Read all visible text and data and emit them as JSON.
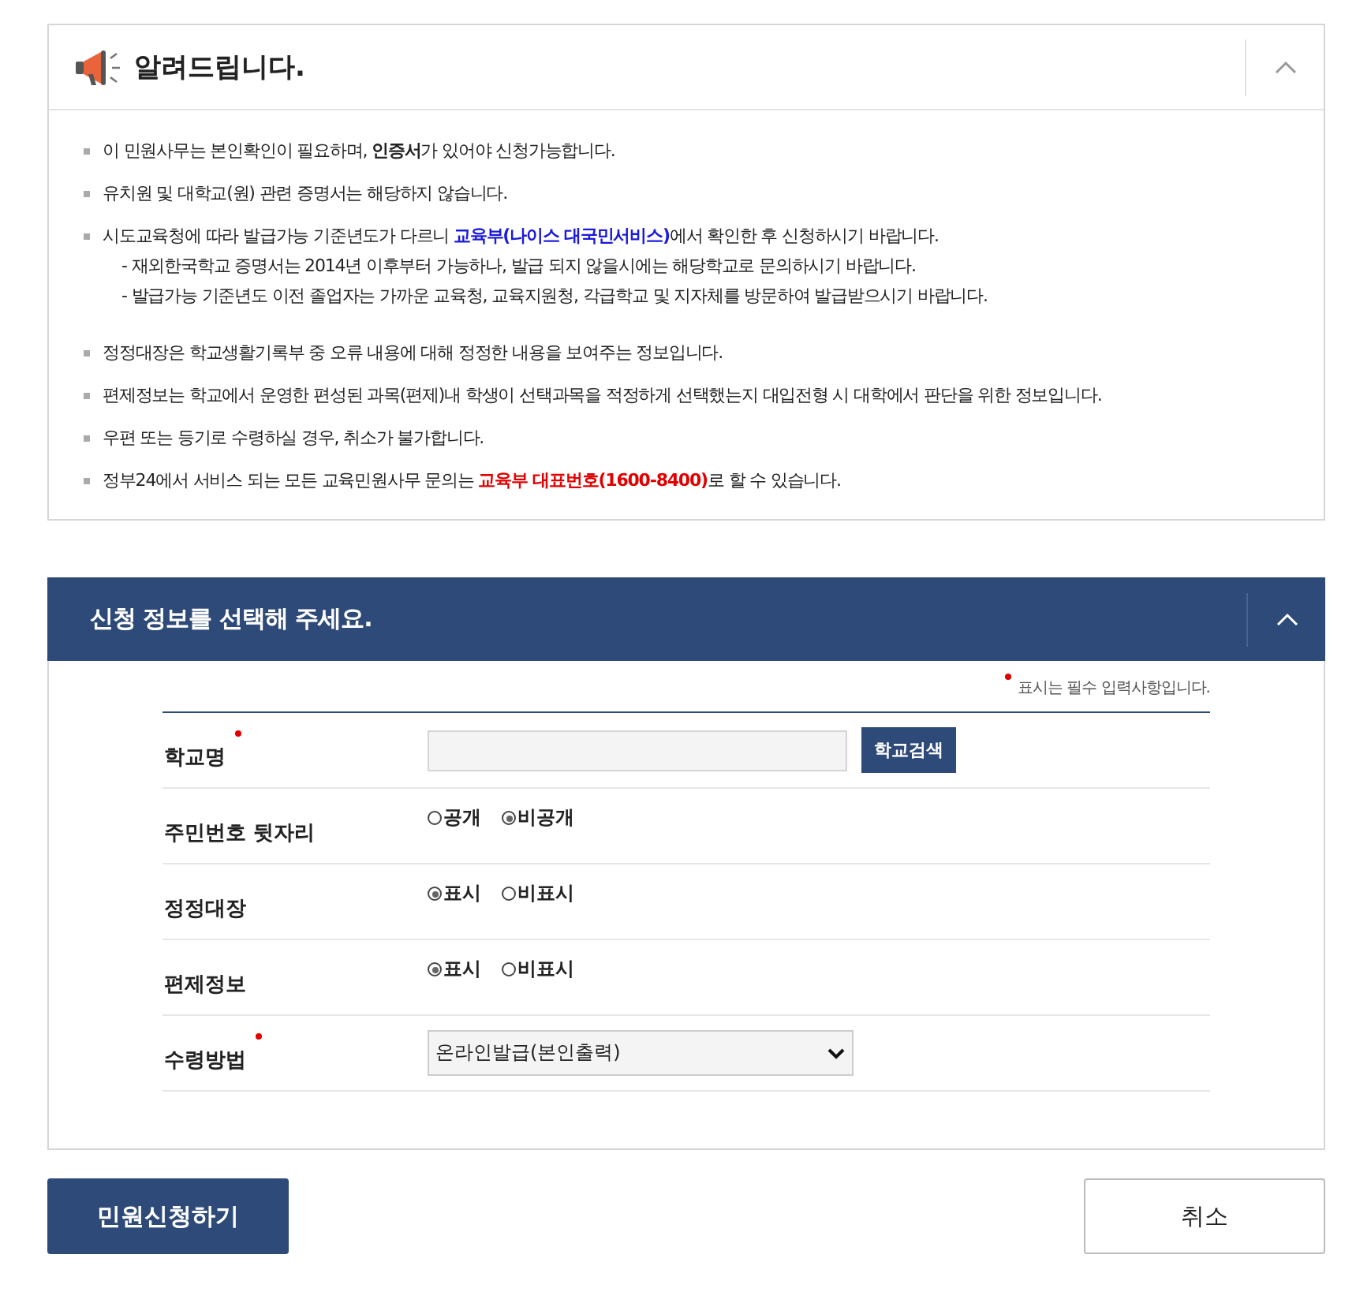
{
  "notice": {
    "title": "알려드립니다.",
    "expanded": true,
    "items": [
      {
        "parts": [
          {
            "kind": "text",
            "text": "이 민원사무는 본인확인이 필요하며, **인증서**가 있어야 신청가능합니다."
          }
        ]
      },
      {
        "parts": [
          {
            "kind": "text",
            "text": "유치원 및 대학교(원) 관련 증명서는 해당하지 않습니다."
          }
        ]
      },
      {
        "parts": [
          {
            "kind": "text",
            "text": "시도교육청에 따라 발급가능 기준년도가 다르니 "
          },
          {
            "kind": "link",
            "text": "교육부(나이스 대국민서비스)"
          },
          {
            "kind": "text",
            "text": "에서 확인한 후 신청하시기 바랍니다."
          }
        ],
        "sub": [
          "- 재외한국학교 증명서는 2014년 이후부터 가능하나, 발급 되지 않을시에는 해당학교로 문의하시기 바랍니다.",
          "- 발급가능 기준년도 이전 졸업자는 가까운 교육청, 교육지원청, 각급학교 및 지자체를 방문하여 발급받으시기 바랍니다."
        ]
      },
      {
        "parts": [
          {
            "kind": "text",
            "text": "정정대장은 학교생활기록부 중 오류 내용에 대해 정정한 내용을 보여주는 정보입니다."
          }
        ]
      },
      {
        "parts": [
          {
            "kind": "text",
            "text": "편제정보는 학교에서 운영한 편성된 과목(편제)내 학생이 선택과목을 적정하게 선택했는지 대입전형 시 대학에서 판단을 위한 정보입니다."
          }
        ]
      },
      {
        "parts": [
          {
            "kind": "text",
            "text": "우편 또는 등기로 수령하실 경우, 취소가 불가합니다."
          }
        ]
      },
      {
        "parts": [
          {
            "kind": "text",
            "text": "정부24에서 서비스 되는 모든 교육민원사무 문의는 "
          },
          {
            "kind": "highlight",
            "text": "교육부 대표번호(1600-8400)"
          },
          {
            "kind": "text",
            "text": "로 할 수 있습니다."
          }
        ]
      }
    ]
  },
  "form": {
    "title": "신청 정보를 선택해 주세요.",
    "expanded": true,
    "required_note": "표시는 필수 입력사항입니다.",
    "rows": [
      {
        "label": "학교명",
        "required": true,
        "kind": "input",
        "button": "학교검색"
      },
      {
        "label": "주민번호 뒷자리",
        "required": false,
        "kind": "radio",
        "options": [
          {
            "label": "공개",
            "selected": false
          },
          {
            "label": "비공개",
            "selected": true
          }
        ]
      },
      {
        "label": "정정대장",
        "required": false,
        "kind": "radio",
        "options": [
          {
            "label": "표시",
            "selected": true
          },
          {
            "label": "비표시",
            "selected": false
          }
        ]
      },
      {
        "label": "편제정보",
        "required": false,
        "kind": "radio",
        "options": [
          {
            "label": "표시",
            "selected": true
          },
          {
            "label": "비표시",
            "selected": false
          }
        ]
      },
      {
        "label": "수령방법",
        "required": true,
        "kind": "select",
        "value": "온라인발급(본인출력)"
      }
    ]
  },
  "actions": {
    "submit": "민원신청하기",
    "cancel": "취소"
  }
}
